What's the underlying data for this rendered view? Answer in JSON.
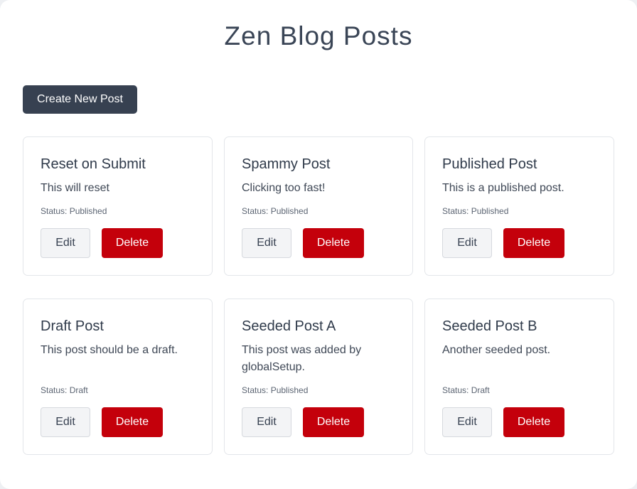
{
  "page": {
    "title": "Zen Blog Posts",
    "create_label": "Create New Post"
  },
  "posts": [
    {
      "title": "Reset on Submit",
      "body": "This will reset",
      "status": "Status: Published",
      "edit_label": "Edit",
      "delete_label": "Delete"
    },
    {
      "title": "Spammy Post",
      "body": "Clicking too fast!",
      "status": "Status: Published",
      "edit_label": "Edit",
      "delete_label": "Delete"
    },
    {
      "title": "Published Post",
      "body": "This is a published post.",
      "status": "Status: Published",
      "edit_label": "Edit",
      "delete_label": "Delete"
    },
    {
      "title": "Draft Post",
      "body": "This post should be a draft.",
      "status": "Status: Draft",
      "edit_label": "Edit",
      "delete_label": "Delete"
    },
    {
      "title": "Seeded Post A",
      "body": "This post was added by globalSetup.",
      "status": "Status: Published",
      "edit_label": "Edit",
      "delete_label": "Delete"
    },
    {
      "title": "Seeded Post B",
      "body": "Another seeded post.",
      "status": "Status: Draft",
      "edit_label": "Edit",
      "delete_label": "Delete"
    }
  ],
  "colors": {
    "primary": "#374151",
    "danger": "#c4000b",
    "background": "#ffffff"
  }
}
